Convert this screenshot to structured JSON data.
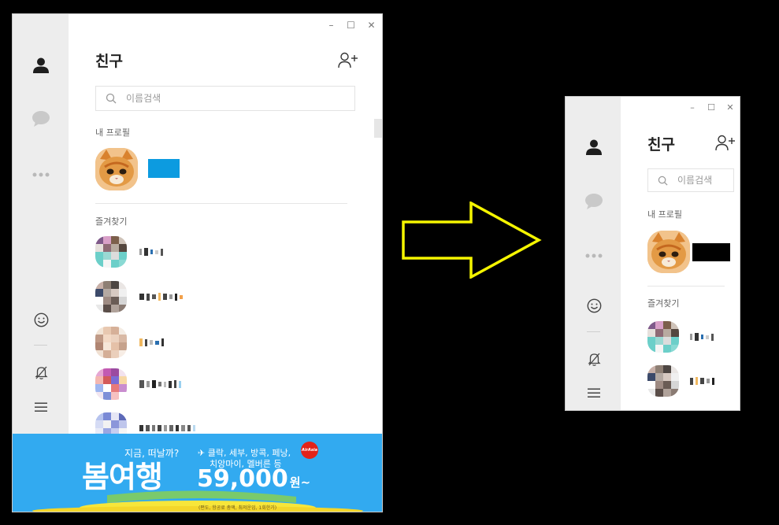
{
  "window_controls": {
    "minimize": "–",
    "maximize": "☐",
    "close": "✕"
  },
  "friends": {
    "title": "친구",
    "search_placeholder": "이름검색",
    "my_profile_label": "내 프로필",
    "favorites_label": "즐겨찾기"
  },
  "sidebar": {
    "icons": [
      "person-icon",
      "chat-bubble-icon",
      "more-dots-icon",
      "emoji-icon",
      "bell-off-icon",
      "menu-icon"
    ]
  },
  "ad": {
    "line1": "지금, 떠날까?",
    "headline": "봄여행",
    "destinations_line1": "✈ 클락, 세부, 방콕, 페낭,",
    "destinations_line2": "치앙마이, 멜버른 등",
    "price": "59,000",
    "price_unit": "원~",
    "footnote": "(편도, 항공료 총액, 최저운임, 1회한가)",
    "brand": "AirAsia"
  },
  "colors": {
    "sidebar": "#ededed",
    "banner": "#32aaf0",
    "accent_box": "#0c9be0",
    "arrow": "#f5f500",
    "brand_red": "#e2231a"
  }
}
